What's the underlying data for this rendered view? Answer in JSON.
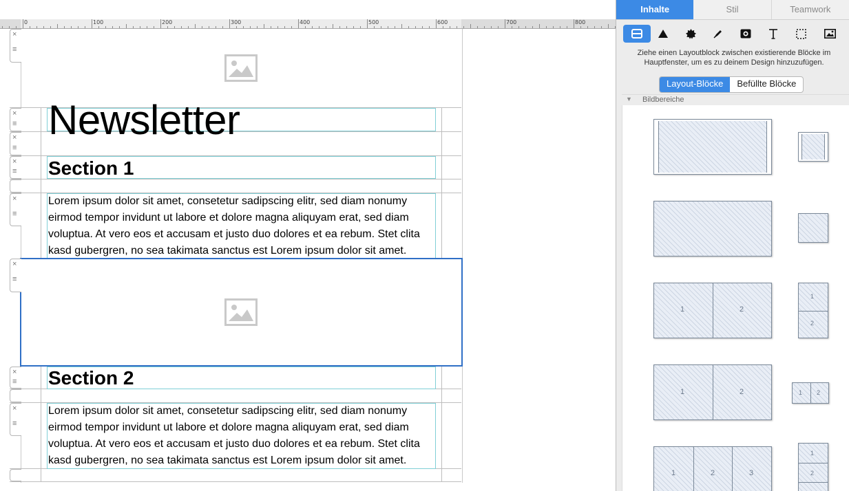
{
  "ruler": {
    "labels": [
      "0",
      "100",
      "200",
      "300",
      "400",
      "500",
      "600",
      "700",
      "800"
    ]
  },
  "document": {
    "title": "Newsletter",
    "sections": [
      {
        "heading": "Section 1",
        "body": "Lorem ipsum dolor sit amet, consetetur sadipscing elitr, sed diam nonumy eirmod tempor invidunt ut labore et dolore magna aliquyam erat, sed diam voluptua. At vero eos et accusam et justo duo dolores et ea rebum. Stet clita kasd gubergren, no sea takimata sanctus est Lorem ipsum dolor sit amet."
      },
      {
        "heading": "Section 2",
        "body": "Lorem ipsum dolor sit amet, consetetur sadipscing elitr, sed diam nonumy eirmod tempor invidunt ut labore et dolore magna aliquyam erat, sed diam voluptua. At vero eos et accusam et justo duo dolores et ea rebum. Stet clita kasd gubergren, no sea takimata sanctus est Lorem ipsum dolor sit amet."
      }
    ],
    "handle_close": "×",
    "handle_drag": "≡"
  },
  "panel": {
    "tabs": [
      "Inhalte",
      "Stil",
      "Teamwork"
    ],
    "active_tab": "Inhalte",
    "toolbar_icons": [
      "layout-block-icon",
      "triangle-icon",
      "badge-icon",
      "pen-icon",
      "media-icon",
      "text-icon",
      "selection-frame-icon",
      "picture-icon"
    ],
    "hint": "Ziehe einen Layoutblock zwischen existierende Blöcke im Hauptfenster, um es zu deinem Design hinzuzufügen.",
    "segments": [
      "Layout-Blöcke",
      "Befüllte Blöcke"
    ],
    "active_segment": "Layout-Blöcke",
    "section_title": "Bildbereiche",
    "block_numbers": {
      "one": "1",
      "two": "2",
      "three": "3"
    }
  },
  "colors": {
    "accent": "#3c8ae5",
    "guide": "#7fcfd6",
    "selection": "#2f6fc6"
  }
}
